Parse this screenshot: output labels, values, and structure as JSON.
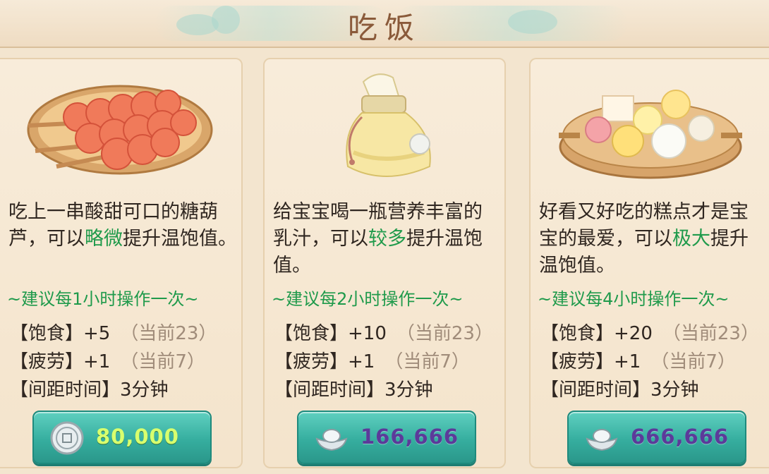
{
  "title": "吃饭",
  "colors": {
    "highlight": "#1f9a4b",
    "button": "#36ae9f",
    "price_silver": "#d8ff6e",
    "price_ingot": "#5c3a9a"
  },
  "cards": [
    {
      "food": "candied-haws",
      "desc_pre": "吃上一串酸甜可口的糖葫芦，可以",
      "desc_hl": "略微",
      "desc_post": "提升温饱值。",
      "advice": "~建议每1小时操作一次~",
      "stats": [
        {
          "label": "【饱食】+5",
          "current": "（当前23）"
        },
        {
          "label": "【疲劳】+1",
          "current": "（当前7）"
        },
        {
          "label": "【间距时间】3分钟",
          "current": ""
        }
      ],
      "currency_icon": "silver-coin-icon",
      "price": "80,000"
    },
    {
      "food": "milk-bottle",
      "desc_pre": "给宝宝喝一瓶营养丰富的乳汁，可以",
      "desc_hl": "较多",
      "desc_post": "提升温饱值。",
      "advice": "~建议每2小时操作一次~",
      "stats": [
        {
          "label": "【饱食】+10",
          "current": "（当前23）"
        },
        {
          "label": "【疲劳】+1",
          "current": "（当前7）"
        },
        {
          "label": "【间距时间】3分钟",
          "current": ""
        }
      ],
      "currency_icon": "silver-ingot-icon",
      "price": "166,666"
    },
    {
      "food": "pastry-steamer",
      "desc_pre": "好看又好吃的糕点才是宝宝的最爱，可以",
      "desc_hl": "极大",
      "desc_post": "提升温饱值。",
      "advice": "~建议每4小时操作一次~",
      "stats": [
        {
          "label": "【饱食】+20",
          "current": "（当前23）"
        },
        {
          "label": "【疲劳】+1",
          "current": "（当前7）"
        },
        {
          "label": "【间距时间】3分钟",
          "current": ""
        }
      ],
      "currency_icon": "silver-ingot-icon",
      "price": "666,666"
    }
  ]
}
